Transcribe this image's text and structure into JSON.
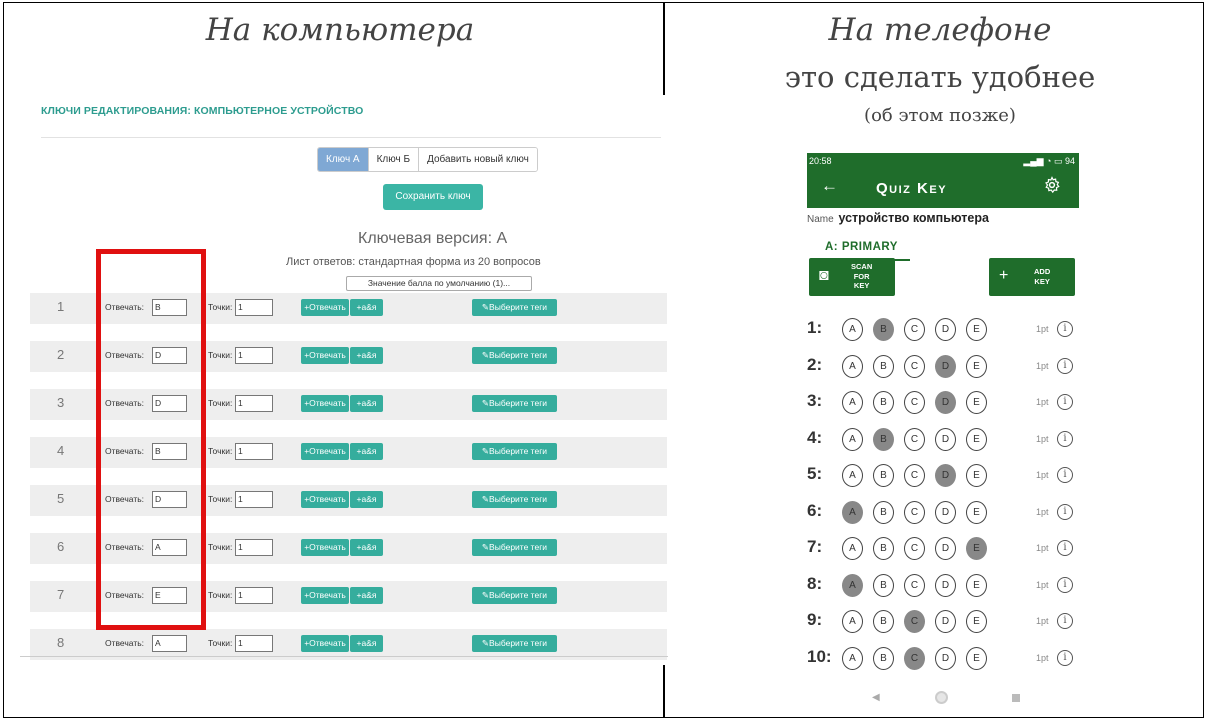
{
  "left": {
    "heading": "На компьютера",
    "title": "КЛЮЧИ РЕДАКТИРОВАНИЯ: КОМПЬЮТЕРНОЕ УСТРОЙСТВО",
    "tabs": [
      "Ключ А",
      "Ключ Б",
      "Добавить новый ключ"
    ],
    "save_label": "Сохранить ключ",
    "key_version": "Ключевая версия: А",
    "answer_sheet": "Лист ответов: стандартная форма из 20 вопросов",
    "default_points": "Значение балла по умолчанию (1)...",
    "answer_label": "Отвечать:",
    "points_label": "Точки:",
    "answer_btn": "+Отвечать",
    "ab_btn": "+а&я",
    "tags_btn": "✎Выберите теги",
    "rows": [
      {
        "num": "1",
        "answer": "B",
        "points": "1"
      },
      {
        "num": "2",
        "answer": "D",
        "points": "1"
      },
      {
        "num": "3",
        "answer": "D",
        "points": "1"
      },
      {
        "num": "4",
        "answer": "B",
        "points": "1"
      },
      {
        "num": "5",
        "answer": "D",
        "points": "1"
      },
      {
        "num": "6",
        "answer": "A",
        "points": "1"
      },
      {
        "num": "7",
        "answer": "E",
        "points": "1"
      },
      {
        "num": "8",
        "answer": "A",
        "points": "1"
      }
    ]
  },
  "right": {
    "heading": "На телефоне",
    "subheading": "это сделать удобнее",
    "note": "(об этом позже)",
    "status_time": "20:58",
    "status_right": "94",
    "app_title": "Quiz Key",
    "name_label": "Name",
    "name_value": "устройство компьютера",
    "tab": "A: PRIMARY",
    "scan_lines": [
      "SCAN",
      "FOR",
      "KEY"
    ],
    "add_lines": [
      "ADD",
      "KEY"
    ],
    "options": [
      "A",
      "B",
      "C",
      "D",
      "E"
    ],
    "points": "1pt",
    "answers": [
      {
        "num": "1:",
        "filled": "B"
      },
      {
        "num": "2:",
        "filled": "D"
      },
      {
        "num": "3:",
        "filled": "D"
      },
      {
        "num": "4:",
        "filled": "B"
      },
      {
        "num": "5:",
        "filled": "D"
      },
      {
        "num": "6:",
        "filled": "A"
      },
      {
        "num": "7:",
        "filled": "E"
      },
      {
        "num": "8:",
        "filled": "A"
      },
      {
        "num": "9:",
        "filled": "C"
      },
      {
        "num": "10:",
        "filled": "C"
      }
    ]
  }
}
